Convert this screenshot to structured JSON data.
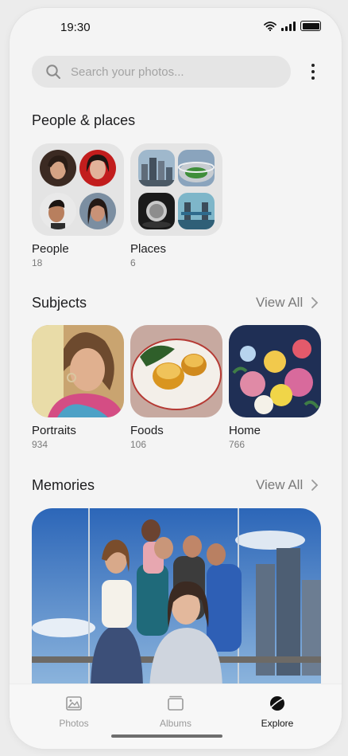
{
  "status_bar": {
    "time": "19:30"
  },
  "search": {
    "placeholder": "Search your photos..."
  },
  "people_places": {
    "title": "People & places",
    "tiles": [
      {
        "label": "People",
        "count": "18"
      },
      {
        "label": "Places",
        "count": "6"
      }
    ]
  },
  "subjects": {
    "title": "Subjects",
    "view_all": "View All",
    "tiles": [
      {
        "label": "Portraits",
        "count": "934"
      },
      {
        "label": "Foods",
        "count": "106"
      },
      {
        "label": "Home",
        "count": "766"
      }
    ]
  },
  "memories": {
    "title": "Memories",
    "view_all": "View All"
  },
  "bottom_nav": {
    "items": [
      {
        "label": "Photos",
        "icon": "photos-icon",
        "active": false
      },
      {
        "label": "Albums",
        "icon": "albums-icon",
        "active": false
      },
      {
        "label": "Explore",
        "icon": "explore-icon",
        "active": true
      }
    ]
  },
  "colors": {
    "background": "#f4f4f4",
    "search_bg": "#e5e5e5",
    "muted_text": "#7a7a7a",
    "active_nav": "#111111"
  }
}
